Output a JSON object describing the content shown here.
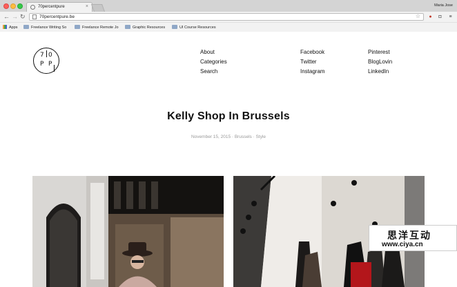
{
  "browser": {
    "tab_title": "70percentpure",
    "tab_close": "×",
    "user_name": "Maria Jose",
    "url": "70percentpure.be",
    "back": "←",
    "forward": "→",
    "reload": "↻",
    "star": "☆",
    "menu": "≡",
    "bookmarks": [
      {
        "label": "Apps",
        "icon": "apps-icon"
      },
      {
        "label": "Freelance Writing So",
        "icon": "folder-icon"
      },
      {
        "label": "Freelance Remote Jo",
        "icon": "folder-icon"
      },
      {
        "label": "Graphic Resources",
        "icon": "folder-icon"
      },
      {
        "label": "UI Course Resources",
        "icon": "folder-icon"
      }
    ]
  },
  "site": {
    "logo": {
      "top_left": "7",
      "top_right": "0",
      "bottom_left": "P",
      "bottom_right": "P"
    },
    "nav_primary": [
      "About",
      "Categories",
      "Search"
    ],
    "nav_social_a": [
      "Facebook",
      "Twitter",
      "Instagram"
    ],
    "nav_social_b": [
      "Pinterest",
      "BlogLovin",
      "LinkedIn"
    ]
  },
  "post": {
    "title": "Kelly Shop In Brussels",
    "meta": "November 15, 2015 · Brussels · Style"
  },
  "watermark": {
    "chinese": "思洋互动",
    "url": "www.ciya.cn"
  },
  "colors": {
    "chrome_bg": "#d9d9d9",
    "text": "#111111",
    "meta_text": "#999999"
  }
}
